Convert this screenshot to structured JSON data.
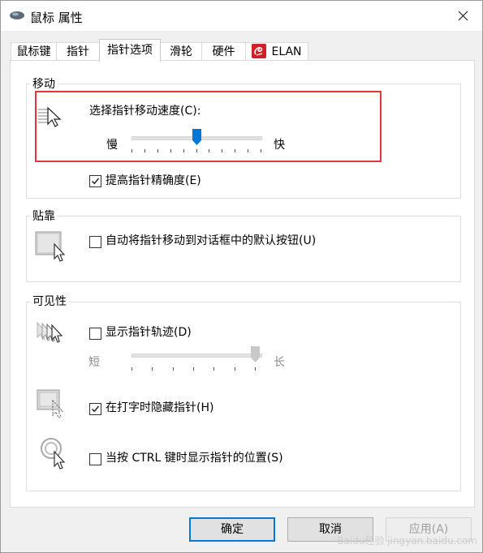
{
  "window": {
    "title": "鼠标 属性",
    "close_icon": "close-icon"
  },
  "tabs": [
    {
      "label": "鼠标键",
      "active": false
    },
    {
      "label": "指针",
      "active": false
    },
    {
      "label": "指针选项",
      "active": true
    },
    {
      "label": "滑轮",
      "active": false
    },
    {
      "label": "硬件",
      "active": false
    },
    {
      "label": "ELAN",
      "active": false,
      "icon": "elan-logo-icon"
    }
  ],
  "motion": {
    "group_label": "移动",
    "speed_label": "选择指针移动速度(C):",
    "slow_label": "慢",
    "fast_label": "快",
    "speed_level": 0.5,
    "precision_label": "提高指针精确度(E)",
    "precision_checked": true
  },
  "snapto": {
    "group_label": "贴靠",
    "auto_label": "自动将指针移动到对话框中的默认按钮(U)",
    "auto_checked": false
  },
  "visibility": {
    "group_label": "可见性",
    "trails_label": "显示指针轨迹(D)",
    "trails_checked": false,
    "short_label": "短",
    "long_label": "长",
    "trail_level": 1.0,
    "hide_typing_label": "在打字时隐藏指针(H)",
    "hide_typing_checked": true,
    "ctrl_label": "当按 CTRL 键时显示指针的位置(S)",
    "ctrl_checked": false
  },
  "buttons": {
    "ok": "确定",
    "cancel": "取消",
    "apply": "应用(A)"
  },
  "watermark": "Baidu经验 jingyan.baidu.com",
  "colors": {
    "accent": "#0078d7",
    "highlight_box": "#e0353b",
    "elan_red": "#d31f26"
  }
}
